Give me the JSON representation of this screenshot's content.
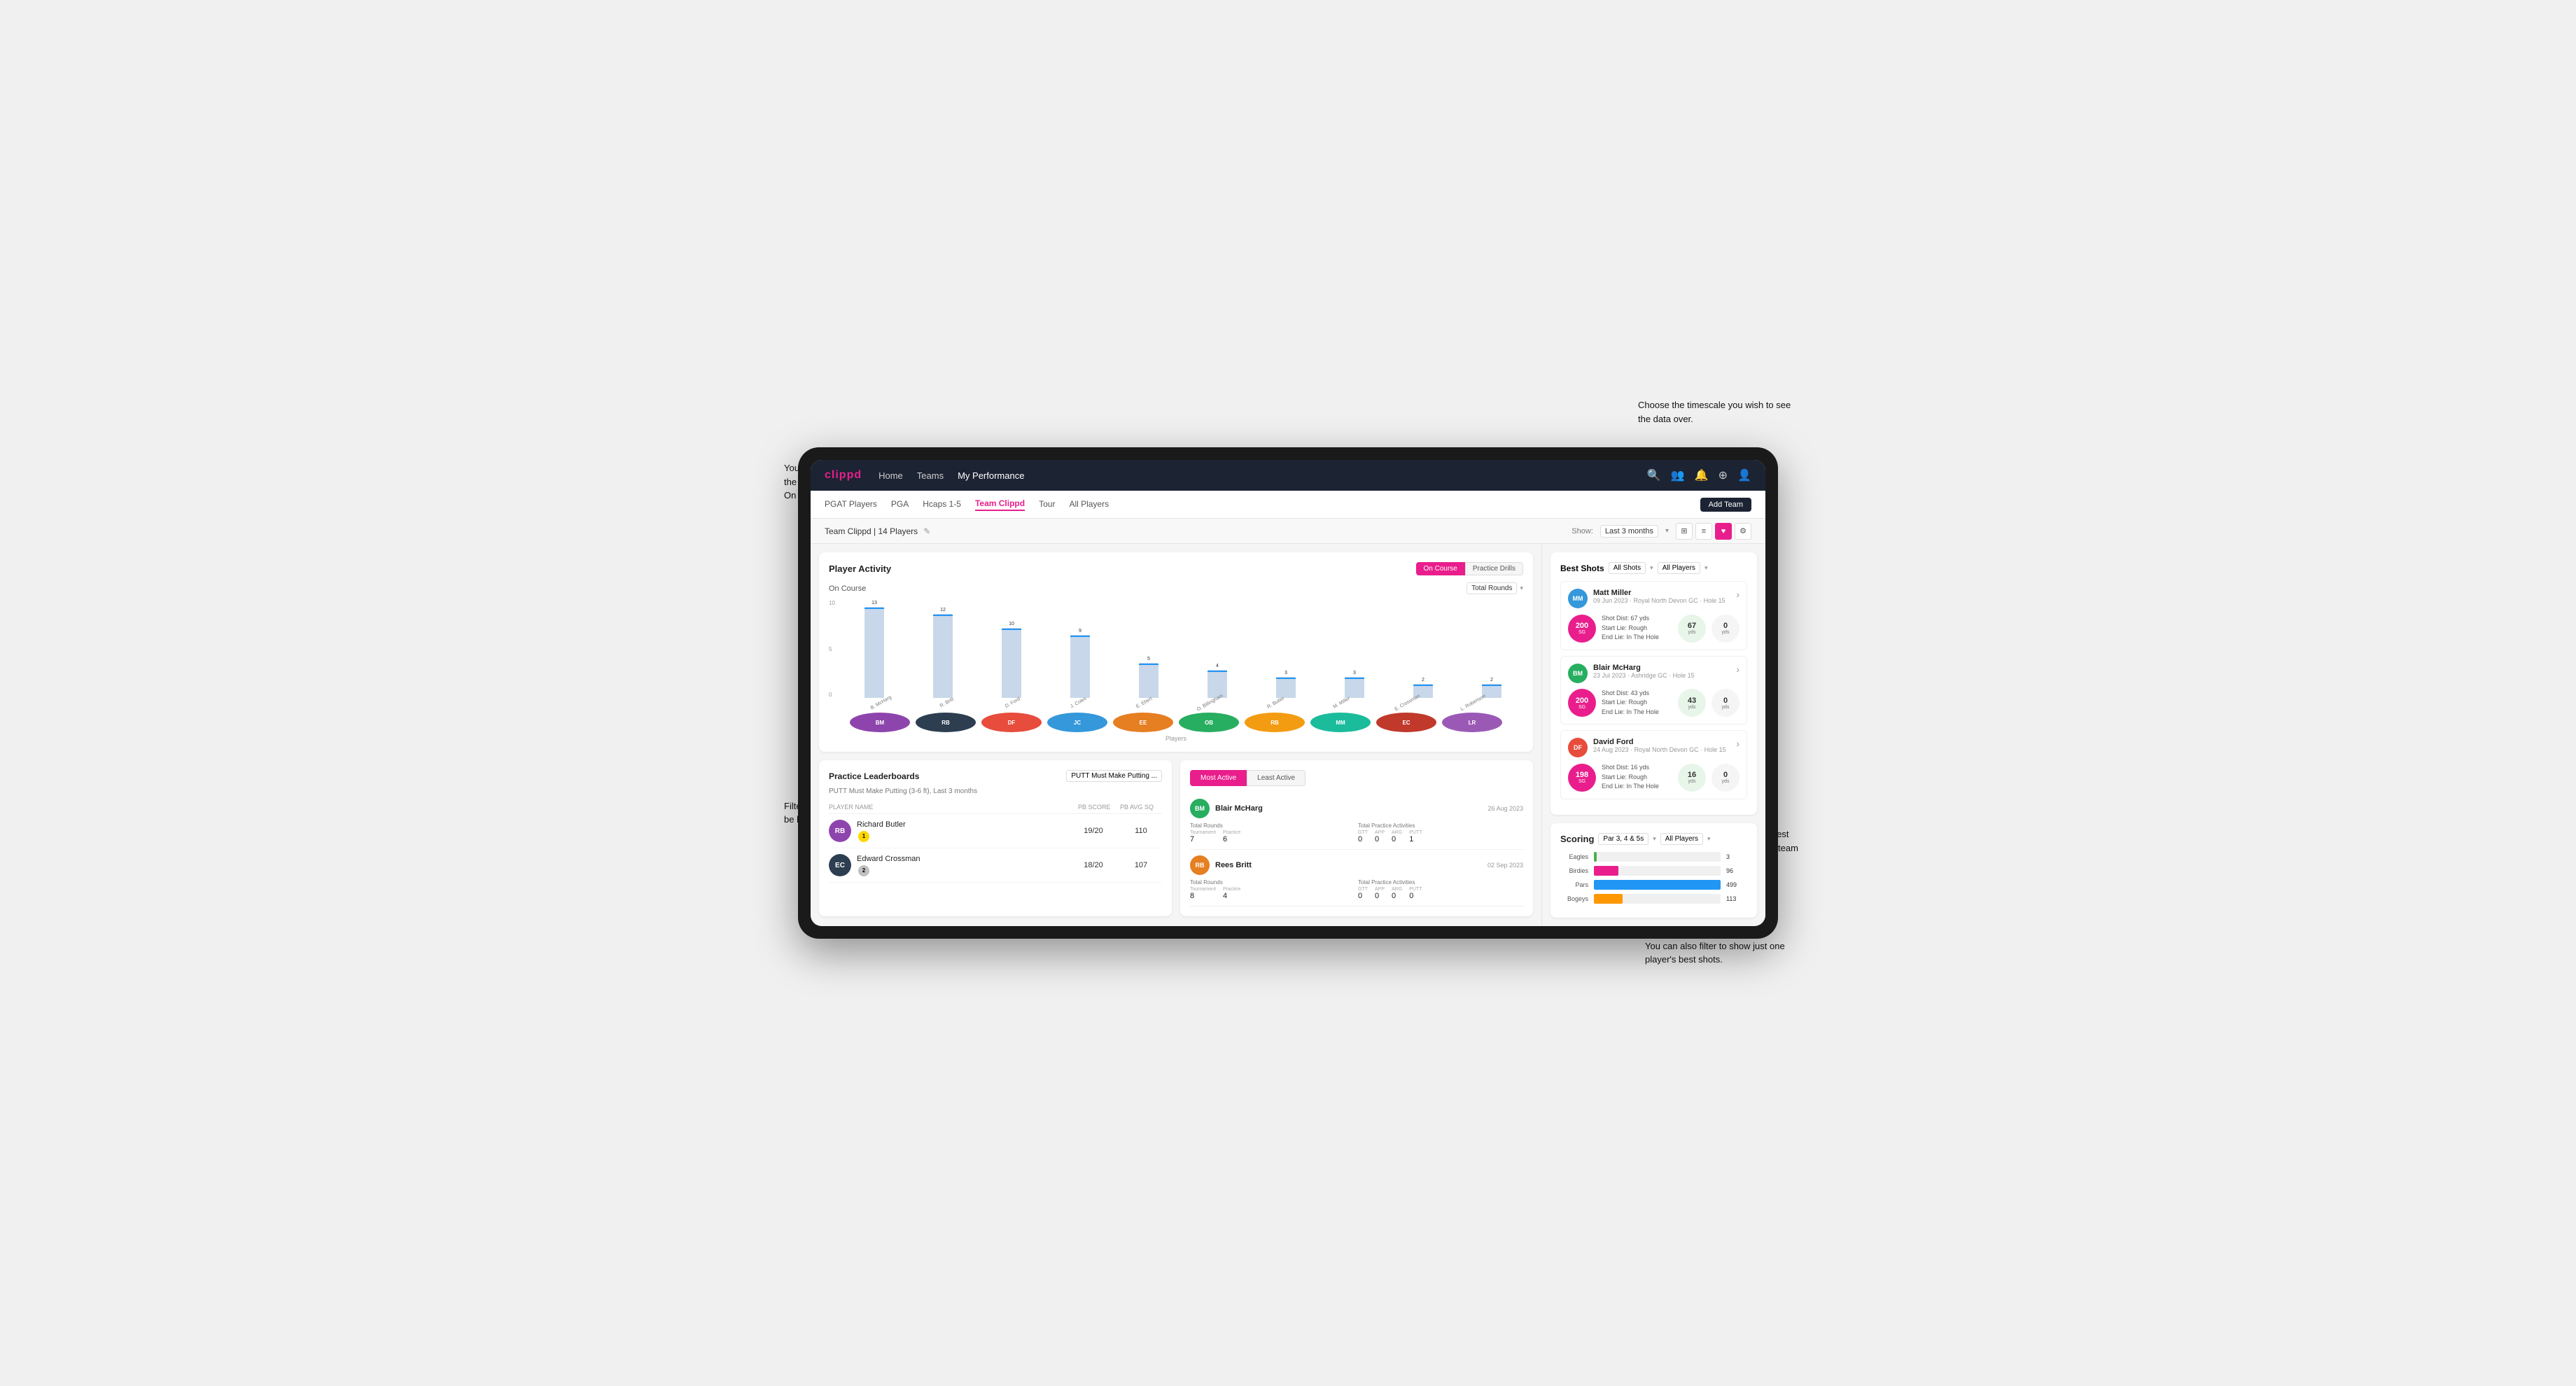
{
  "annotations": {
    "top_right": "Choose the timescale you wish to see the data over.",
    "top_left": "You can select which player is doing the best in a range of areas for both On Course and Practice Drills.",
    "bottom_left": "Filter what data you wish the table to be based on.",
    "bottom_right": "Here you can see who's hit the best shots out of all the players in the team for each department.",
    "bottom_right2": "You can also filter to show just one player's best shots."
  },
  "top_nav": {
    "brand": "clippd",
    "items": [
      "Home",
      "Teams",
      "My Performance"
    ],
    "active": "My Performance"
  },
  "sub_nav": {
    "items": [
      "PGAT Players",
      "PGA",
      "Hcaps 1-5",
      "Team Clippd",
      "Tour",
      "All Players"
    ],
    "active": "Team Clippd",
    "add_btn": "Add Team"
  },
  "team_header": {
    "name": "Team Clippd | 14 Players",
    "show_label": "Show:",
    "show_value": "Last 3 months",
    "view_options": [
      "grid",
      "list",
      "heart",
      "settings"
    ]
  },
  "player_activity": {
    "title": "Player Activity",
    "toggle": [
      "On Course",
      "Practice Drills"
    ],
    "active_toggle": "On Course",
    "section_title": "On Course",
    "dropdown": "Total Rounds",
    "y_axis": [
      "0",
      "5",
      "10"
    ],
    "bars": [
      {
        "name": "B. McHarg",
        "value": 13,
        "height": 130
      },
      {
        "name": "R. Britt",
        "value": 12,
        "height": 120
      },
      {
        "name": "D. Ford",
        "value": 10,
        "height": 100
      },
      {
        "name": "J. Coles",
        "value": 9,
        "height": 90
      },
      {
        "name": "E. Ebert",
        "value": 5,
        "height": 50
      },
      {
        "name": "O. Billingham",
        "value": 4,
        "height": 40
      },
      {
        "name": "R. Butler",
        "value": 3,
        "height": 30
      },
      {
        "name": "M. Miller",
        "value": 3,
        "height": 30
      },
      {
        "name": "E. Crossman",
        "value": 2,
        "height": 20
      },
      {
        "name": "L. Robertson",
        "value": 2,
        "height": 20
      }
    ],
    "x_label": "Players",
    "y_label": "Total Rounds"
  },
  "practice_leaderboards": {
    "title": "Practice Leaderboards",
    "dropdown": "PUTT Must Make Putting ...",
    "subtitle": "PUTT Must Make Putting (3-6 ft), Last 3 months",
    "cols": [
      "PLAYER NAME",
      "PB SCORE",
      "PB AVG SQ"
    ],
    "rows": [
      {
        "name": "Richard Butler",
        "badge": "1",
        "badge_type": "gold",
        "pb_score": "19/20",
        "pb_avg": "110"
      },
      {
        "name": "Edward Crossman",
        "badge": "2",
        "badge_type": "silver",
        "pb_score": "18/20",
        "pb_avg": "107"
      }
    ]
  },
  "most_active": {
    "tabs": [
      "Most Active",
      "Least Active"
    ],
    "active_tab": "Most Active",
    "players": [
      {
        "name": "Blair McHarg",
        "date": "26 Aug 2023",
        "total_rounds": {
          "tournament": "7",
          "practice": "6"
        },
        "total_practice": {
          "gtt": "0",
          "app": "0",
          "arg": "0",
          "putt": "1"
        }
      },
      {
        "name": "Rees Britt",
        "date": "02 Sep 2023",
        "total_rounds": {
          "tournament": "8",
          "practice": "4"
        },
        "total_practice": {
          "gtt": "0",
          "app": "0",
          "arg": "0",
          "putt": "0"
        }
      }
    ]
  },
  "best_shots": {
    "title": "Best Shots",
    "filter1": "All Shots",
    "filter2": "All Players",
    "shots": [
      {
        "player": "Matt Miller",
        "date": "09 Jun 2023",
        "course": "Royal North Devon GC",
        "hole": "Hole 15",
        "score": "200",
        "score_sub": "SG",
        "dist": "Shot Dist: 67 yds\nStart Lie: Rough\nEnd Lie: In The Hole",
        "yds1": "67",
        "yds2": "0"
      },
      {
        "player": "Blair McHarg",
        "date": "23 Jul 2023",
        "course": "Ashridge GC",
        "hole": "Hole 15",
        "score": "200",
        "score_sub": "SG",
        "dist": "Shot Dist: 43 yds\nStart Lie: Rough\nEnd Lie: In The Hole",
        "yds1": "43",
        "yds2": "0"
      },
      {
        "player": "David Ford",
        "date": "24 Aug 2023",
        "course": "Royal North Devon GC",
        "hole": "Hole 15",
        "score": "198",
        "score_sub": "SG",
        "dist": "Shot Dist: 16 yds\nStart Lie: Rough\nEnd Lie: In The Hole",
        "yds1": "16",
        "yds2": "0"
      }
    ]
  },
  "scoring": {
    "title": "Scoring",
    "filter1": "Par 3, 4 & 5s",
    "filter2": "All Players",
    "rows": [
      {
        "label": "Eagles",
        "value": 3,
        "max": 500,
        "color": "#4caf50"
      },
      {
        "label": "Birdies",
        "value": 96,
        "max": 500,
        "color": "#e91e8c"
      },
      {
        "label": "Pars",
        "value": 499,
        "max": 500,
        "color": "#2196f3"
      },
      {
        "label": "Bogeys",
        "value": 113,
        "max": 500,
        "color": "#ff9800"
      }
    ]
  }
}
